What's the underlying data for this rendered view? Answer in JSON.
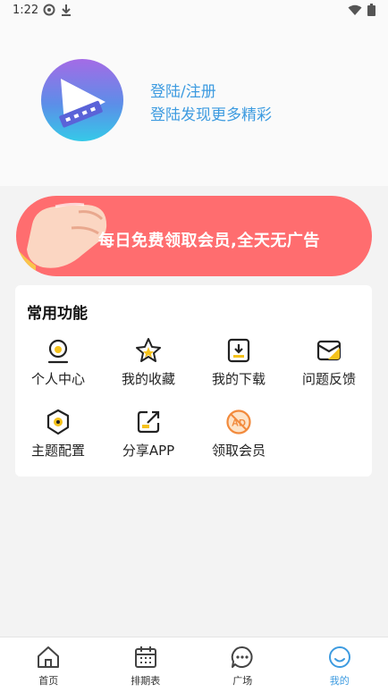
{
  "status": {
    "time": "1:22"
  },
  "profile": {
    "login_label": "登陆/注册",
    "subtitle": "登陆发现更多精彩"
  },
  "banner": {
    "text": "每日免费领取会员,全天无广告"
  },
  "features": {
    "title": "常用功能",
    "items": [
      {
        "label": "个人中心",
        "icon": "person-center-icon"
      },
      {
        "label": "我的收藏",
        "icon": "star-icon"
      },
      {
        "label": "我的下载",
        "icon": "download-icon"
      },
      {
        "label": "问题反馈",
        "icon": "feedback-mail-icon"
      },
      {
        "label": "主题配置",
        "icon": "theme-icon"
      },
      {
        "label": "分享APP",
        "icon": "share-icon"
      },
      {
        "label": "领取会员",
        "icon": "ad-free-icon"
      }
    ]
  },
  "nav": {
    "items": [
      {
        "label": "首页",
        "icon": "home-icon"
      },
      {
        "label": "排期表",
        "icon": "calendar-icon"
      },
      {
        "label": "广场",
        "icon": "chat-icon"
      },
      {
        "label": "我的",
        "icon": "smiley-icon"
      }
    ],
    "active_index": 3
  },
  "colors": {
    "accent": "#3d9be0",
    "banner": "#ff6d6f",
    "icon_yellow": "#f5c21b"
  }
}
